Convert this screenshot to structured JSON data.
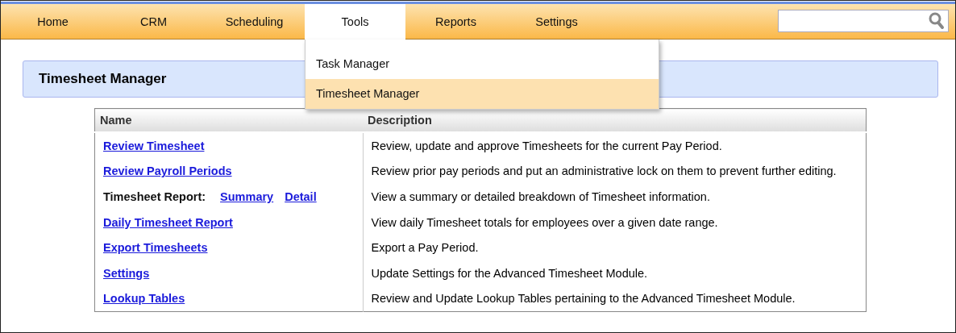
{
  "nav": [
    {
      "label": "Home",
      "selected": false
    },
    {
      "label": "CRM",
      "selected": false
    },
    {
      "label": "Scheduling",
      "selected": false
    },
    {
      "label": "Tools",
      "selected": true
    },
    {
      "label": "Reports",
      "selected": false
    },
    {
      "label": "Settings",
      "selected": false
    }
  ],
  "search_box": true,
  "dropdown": [
    {
      "label": "Task Manager",
      "selected": false
    },
    {
      "label": "Timesheet Manager",
      "selected": true
    }
  ],
  "page_title": "Timesheet Manager",
  "table": {
    "columns": [
      "Name",
      "Description"
    ],
    "rows": [
      {
        "kind": "link",
        "name": "Review Timesheet",
        "description": "Review, update and approve Timesheets for the current Pay Period."
      },
      {
        "kind": "link",
        "name": "Review Payroll Periods",
        "description": "Review prior pay periods and put an administrative lock on them to prevent further editing."
      },
      {
        "kind": "report",
        "name": "Timesheet Report:",
        "links": [
          "Summary",
          "Detail"
        ],
        "description": "View a summary or detailed breakdown of Timesheet information."
      },
      {
        "kind": "link",
        "name": "Daily Timesheet Report",
        "description": "View daily Timesheet totals for employees over a given date range."
      },
      {
        "kind": "link",
        "name": "Export Timesheets",
        "description": "Export a Pay Period."
      },
      {
        "kind": "link",
        "name": "Settings",
        "description": "Update Settings for the Advanced Timesheet Module."
      },
      {
        "kind": "link",
        "name": "Lookup Tables",
        "description": "Review and Update Lookup Tables pertaining to the Advanced Timesheet Module."
      }
    ]
  }
}
